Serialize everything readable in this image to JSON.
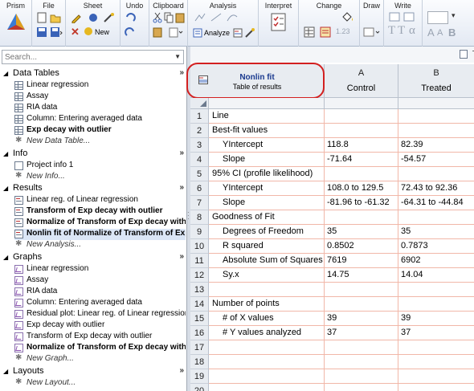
{
  "ribbon": {
    "groups": [
      "Prism",
      "File",
      "Sheet",
      "Undo",
      "Clipboard",
      "Analysis",
      "Interpret",
      "Change",
      "Draw",
      "Write"
    ],
    "new_label": "New",
    "analyze_label": "Analyze",
    "colors": {
      "accent": "#1a3a8f",
      "highlight": "#d32020"
    }
  },
  "navigator": {
    "search_placeholder": "Search...",
    "sections": {
      "data_tables": {
        "label": "Data Tables",
        "items": [
          "Linear regression",
          "Assay",
          "RIA data",
          "Column: Entering averaged data",
          "Exp decay with outlier"
        ],
        "new_label": "New Data Table..."
      },
      "info": {
        "label": "Info",
        "items": [
          "Project info 1"
        ],
        "new_label": "New Info..."
      },
      "results": {
        "label": "Results",
        "items": [
          "Linear reg. of Linear regression",
          "Transform of Exp decay with outlier",
          "Normalize of Transform of Exp decay with ...",
          "Nonlin fit of Normalize of Transform of Exp..."
        ],
        "new_label": "New Analysis..."
      },
      "graphs": {
        "label": "Graphs",
        "items": [
          "Linear regression",
          "Assay",
          "RIA data",
          "Column: Entering averaged data",
          "Residual plot: Linear reg. of Linear regression",
          "Exp decay with outlier",
          "Transform of Exp decay with outlier",
          "Normalize of Transform of Exp decay with ..."
        ],
        "new_label": "New Graph..."
      },
      "layouts": {
        "label": "Layouts",
        "new_label": "New Layout..."
      }
    },
    "expand_glyph": "»"
  },
  "sheet": {
    "title": "Nonlin fit",
    "subtitle": "Table of results",
    "toolbar_glyph": "T",
    "columns": [
      {
        "letter": "A",
        "name": "Control"
      },
      {
        "letter": "B",
        "name": "Treated"
      }
    ],
    "rows": [
      {
        "num": "1",
        "label": "Line",
        "a": "",
        "b": "",
        "indent": false
      },
      {
        "num": "2",
        "label": "Best-fit values",
        "a": "",
        "b": "",
        "indent": false
      },
      {
        "num": "3",
        "label": "YIntercept",
        "a": "118.8",
        "b": "82.39",
        "indent": true
      },
      {
        "num": "4",
        "label": "Slope",
        "a": "-71.64",
        "b": "-54.57",
        "indent": true
      },
      {
        "num": "5",
        "label": "95% CI (profile likelihood)",
        "a": "",
        "b": "",
        "indent": false
      },
      {
        "num": "6",
        "label": "YIntercept",
        "a": "108.0 to 129.5",
        "b": "72.43 to 92.36",
        "indent": true
      },
      {
        "num": "7",
        "label": "Slope",
        "a": "-81.96 to -61.32",
        "b": "-64.31 to -44.84",
        "indent": true
      },
      {
        "num": "8",
        "label": "Goodness of Fit",
        "a": "",
        "b": "",
        "indent": false
      },
      {
        "num": "9",
        "label": "Degrees of Freedom",
        "a": "35",
        "b": "35",
        "indent": true
      },
      {
        "num": "10",
        "label": "R squared",
        "a": "0.8502",
        "b": "0.7873",
        "indent": true
      },
      {
        "num": "11",
        "label": "Absolute Sum of Squares",
        "a": "7619",
        "b": "6902",
        "indent": true
      },
      {
        "num": "12",
        "label": "Sy.x",
        "a": "14.75",
        "b": "14.04",
        "indent": true
      },
      {
        "num": "13",
        "label": "",
        "a": "",
        "b": "",
        "indent": false
      },
      {
        "num": "14",
        "label": "Number of points",
        "a": "",
        "b": "",
        "indent": false
      },
      {
        "num": "15",
        "label": "# of X values",
        "a": "39",
        "b": "39",
        "indent": true
      },
      {
        "num": "16",
        "label": "# Y values analyzed",
        "a": "37",
        "b": "37",
        "indent": true
      },
      {
        "num": "17",
        "label": "",
        "a": "",
        "b": "",
        "indent": false
      },
      {
        "num": "18",
        "label": "",
        "a": "",
        "b": "",
        "indent": false
      },
      {
        "num": "19",
        "label": "",
        "a": "",
        "b": "",
        "indent": false
      },
      {
        "num": "20",
        "label": "",
        "a": "",
        "b": "",
        "indent": false
      }
    ]
  }
}
